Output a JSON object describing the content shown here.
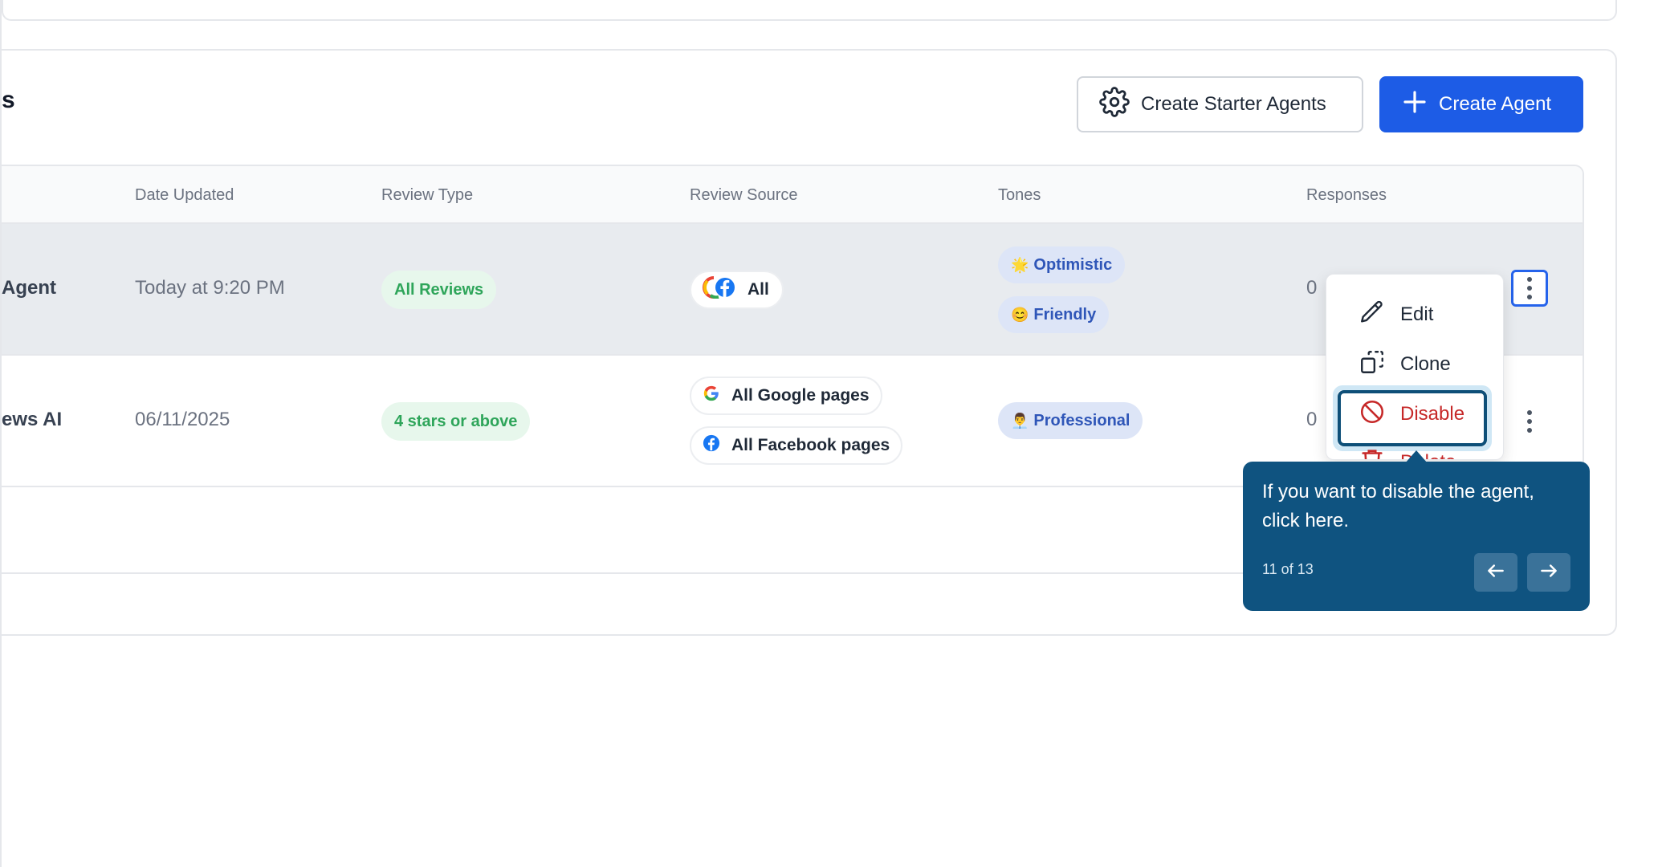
{
  "card": {
    "title_fragment": "s",
    "starter_button_label": "Create Starter Agents",
    "create_button_label": "Create Agent"
  },
  "table": {
    "headers": {
      "date_updated": "Date Updated",
      "review_type": "Review Type",
      "review_source": "Review Source",
      "tones": "Tones",
      "responses": "Responses"
    },
    "rows": [
      {
        "name": "Agent",
        "date": "Today at 9:20 PM",
        "review_type": "All Reviews",
        "sources": [
          "All"
        ],
        "tones": [
          {
            "emoji": "🌟",
            "label": "Optimistic"
          },
          {
            "emoji": "😊",
            "label": "Friendly"
          }
        ],
        "responses": "0"
      },
      {
        "name": "ews AI",
        "date": "06/11/2025",
        "review_type": "4 stars or above",
        "sources": [
          "All Google pages",
          "All Facebook pages"
        ],
        "tones": [
          {
            "emoji": "👨‍💼",
            "label": "Professional"
          }
        ],
        "responses": "0"
      }
    ]
  },
  "menu": {
    "edit": "Edit",
    "clone": "Clone",
    "disable": "Disable",
    "delete_partial": "Delete"
  },
  "tooltip": {
    "text": "If you want to disable the agent, click here.",
    "step": "11 of 13"
  },
  "colors": {
    "primary": "#1d5ce6",
    "tooltip_bg": "#0f5380",
    "danger": "#c62828",
    "green_badge_text": "#2ea55a",
    "tone_badge_text": "#2f56b8"
  }
}
